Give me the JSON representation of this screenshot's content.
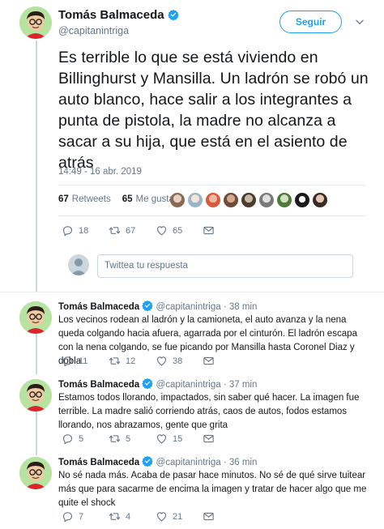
{
  "main_tweet": {
    "author_name": "Tomás Balmaceda",
    "handle": "@capitanintriga",
    "follow_label": "Seguir",
    "text": "Es terrible lo que se está viviendo en Billinghurst y Mansilla. Un ladrón se robó un auto blanco, hace salir a los integrantes a punta de pistola, la madre no alcanza a sacar a su hija, que está en el asiento de atrás",
    "timestamp": "14:49 - 16 abr. 2019",
    "retweets_count": "67",
    "retweets_label": "Retweets",
    "likes_count": "65",
    "likes_label": "Me gusta",
    "actions": {
      "replies": "18",
      "retweets": "67",
      "likes": "65"
    }
  },
  "reply_box": {
    "placeholder": "Twittea tu respuesta"
  },
  "replies": [
    {
      "author_name": "Tomás Balmaceda",
      "handle": "@capitanintriga",
      "age": "· 38 min",
      "text": "Los vecinos rodean al ladrón y la camioneta, el auto avanza y la nena queda colgando hacia afuera, agarrada por el cinturón. El ladrón escapa con la nena colgando, se fue picando por Mansilla hasta Coronel Diaz y dobla",
      "replies": "11",
      "retweets": "12",
      "likes": "38"
    },
    {
      "author_name": "Tomás Balmaceda",
      "handle": "@capitanintriga",
      "age": "· 37 min",
      "text": "Estamos todos llorando, impactados, sin saber qué hacer. La imagen fue terrible. La madre salió corriendo atrás, caos de autos, fodos estamos llorando, nos abrazamos, gente que grita",
      "replies": "5",
      "retweets": "5",
      "likes": "15"
    },
    {
      "author_name": "Tomás Balmaceda",
      "handle": "@capitanintriga",
      "age": "· 36 min",
      "text": "No sé nada más. Acaba de pasar hace minutos. No sé de qué sirve tuitear más que para sacarme de encima la imagen y tratar de hacer algo que me quite el shock",
      "replies": "7",
      "retweets": "4",
      "likes": "21"
    }
  ],
  "icons": {
    "verified": "verified-badge-icon",
    "reply": "reply-icon",
    "retweet": "retweet-icon",
    "like": "heart-icon",
    "dm": "envelope-icon",
    "more": "chevron-down-icon"
  },
  "colors": {
    "accent": "#1da1f2",
    "muted": "#657786",
    "text": "#14171a",
    "divider": "#e6ecf0"
  }
}
